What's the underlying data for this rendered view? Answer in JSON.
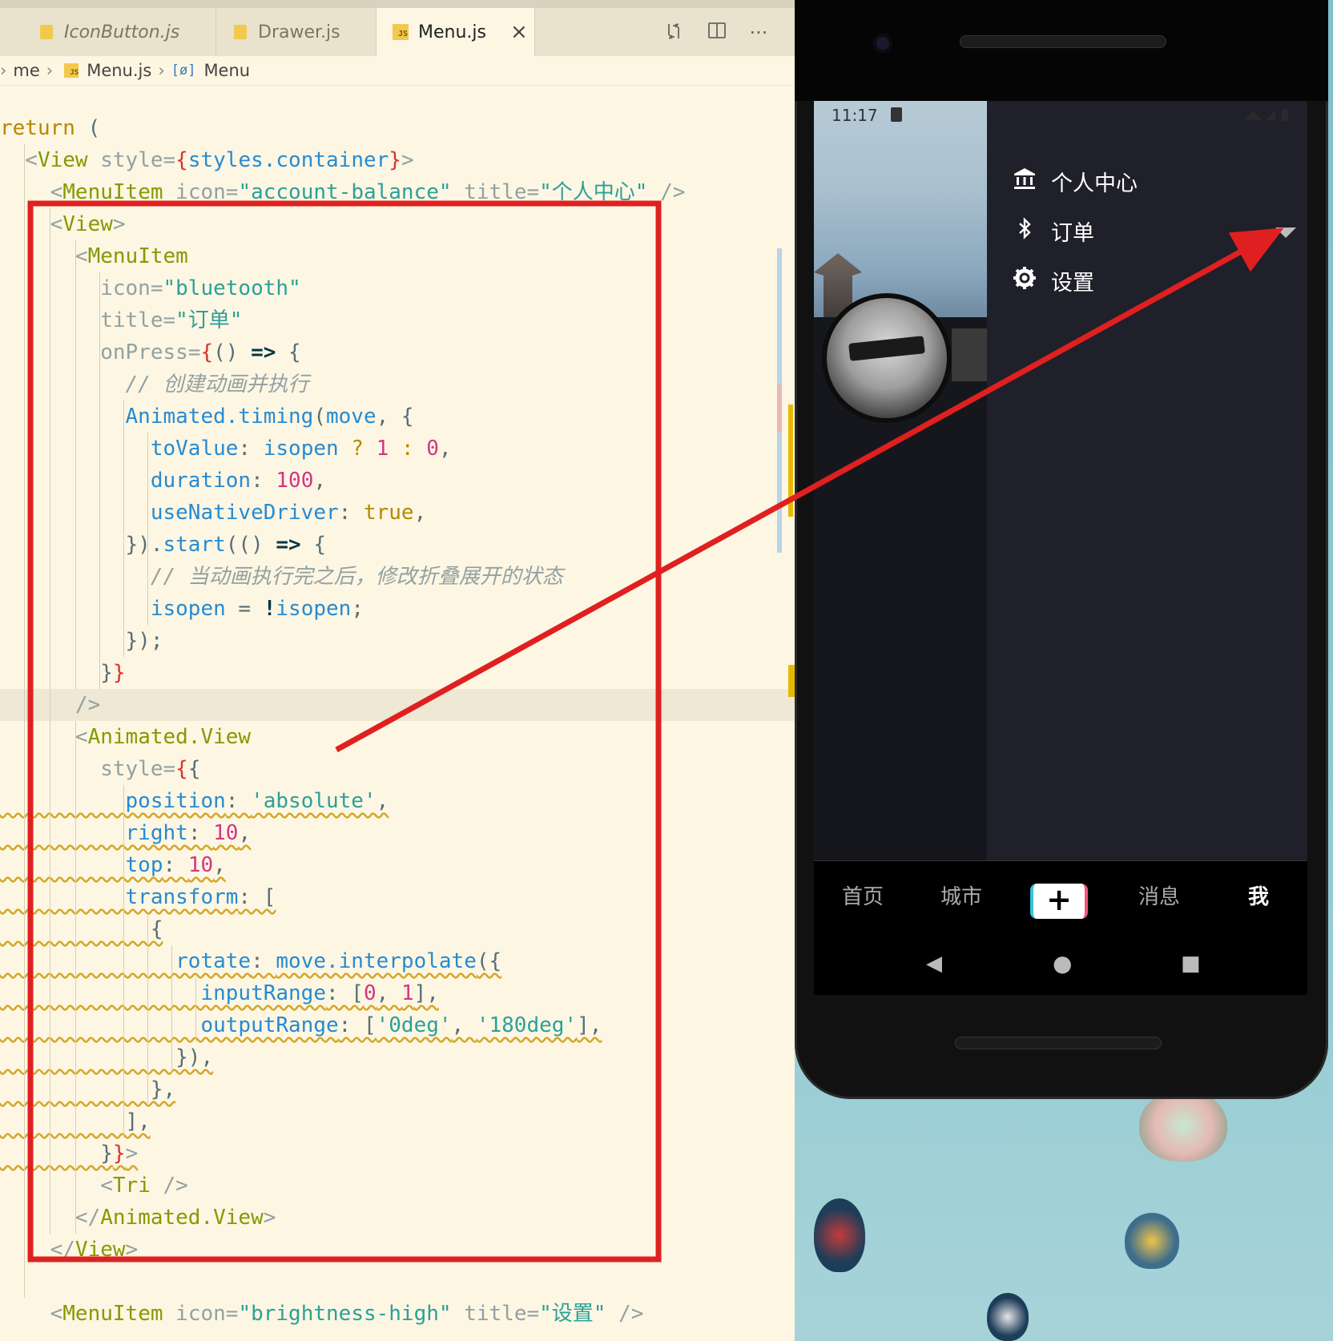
{
  "editor": {
    "tabs": [
      {
        "label": "IconButton.js",
        "active": false
      },
      {
        "label": "Drawer.js",
        "active": false
      },
      {
        "label": "Menu.js",
        "active": true
      }
    ],
    "tab_close": "×",
    "toolbar_icons": [
      "compare-changes-icon",
      "split-editor-icon",
      "more-actions-icon"
    ],
    "toolbar_more": "···",
    "breadcrumb": {
      "parts": [
        "me",
        "Menu.js",
        "Menu"
      ],
      "sep": "›",
      "symbol": "[ø]"
    },
    "js_badge": "JS",
    "colors": {
      "keyword": "#b58900",
      "tag": "#859900",
      "string": "#2aa198",
      "number": "#d33682",
      "property": "#268bd2",
      "comment": "#93a1a1",
      "background": "#fdf6e3"
    },
    "code_lines": [
      [
        {
          "t": "return",
          "c": "kw"
        },
        {
          "t": " (",
          "c": "pun"
        }
      ],
      [
        {
          "t": "  <",
          "c": "attr"
        },
        {
          "t": "View",
          "c": "tag"
        },
        {
          "t": " style=",
          "c": "attr"
        },
        {
          "t": "{",
          "c": "br"
        },
        {
          "t": "styles.container",
          "c": "prop"
        },
        {
          "t": "}",
          "c": "br"
        },
        {
          "t": ">",
          "c": "attr"
        }
      ],
      [
        {
          "t": "    <",
          "c": "attr"
        },
        {
          "t": "MenuItem",
          "c": "tag"
        },
        {
          "t": " icon=",
          "c": "attr"
        },
        {
          "t": "\"account-balance\"",
          "c": "str"
        },
        {
          "t": " title=",
          "c": "attr"
        },
        {
          "t": "\"个人中心\"",
          "c": "str"
        },
        {
          "t": " />",
          "c": "attr"
        }
      ],
      [
        {
          "t": "    <",
          "c": "attr"
        },
        {
          "t": "View",
          "c": "tag"
        },
        {
          "t": ">",
          "c": "attr"
        }
      ],
      [
        {
          "t": "      <",
          "c": "attr"
        },
        {
          "t": "MenuItem",
          "c": "tag"
        }
      ],
      [
        {
          "t": "        icon=",
          "c": "attr"
        },
        {
          "t": "\"bluetooth\"",
          "c": "str"
        }
      ],
      [
        {
          "t": "        title=",
          "c": "attr"
        },
        {
          "t": "\"订单\"",
          "c": "str"
        }
      ],
      [
        {
          "t": "        onPress=",
          "c": "attr"
        },
        {
          "t": "{",
          "c": "br"
        },
        {
          "t": "() ",
          "c": "pun"
        },
        {
          "t": "=>",
          "c": "op"
        },
        {
          "t": " {",
          "c": "pun"
        }
      ],
      [
        {
          "t": "          // 创建动画并执行",
          "c": "cm"
        }
      ],
      [
        {
          "t": "          Animated.timing",
          "c": "prop"
        },
        {
          "t": "(",
          "c": "pun"
        },
        {
          "t": "move",
          "c": "prop"
        },
        {
          "t": ", {",
          "c": "pun"
        }
      ],
      [
        {
          "t": "            toValue",
          "c": "prop"
        },
        {
          "t": ": ",
          "c": "pun"
        },
        {
          "t": "isopen",
          "c": "prop"
        },
        {
          "t": " ? ",
          "c": "kw"
        },
        {
          "t": "1",
          "c": "num"
        },
        {
          "t": " : ",
          "c": "kw"
        },
        {
          "t": "0",
          "c": "num"
        },
        {
          "t": ",",
          "c": "pun"
        }
      ],
      [
        {
          "t": "            duration",
          "c": "prop"
        },
        {
          "t": ": ",
          "c": "pun"
        },
        {
          "t": "100",
          "c": "num"
        },
        {
          "t": ",",
          "c": "pun"
        }
      ],
      [
        {
          "t": "            useNativeDriver",
          "c": "prop"
        },
        {
          "t": ": ",
          "c": "pun"
        },
        {
          "t": "true",
          "c": "kw"
        },
        {
          "t": ",",
          "c": "pun"
        }
      ],
      [
        {
          "t": "          }).",
          "c": "pun"
        },
        {
          "t": "start",
          "c": "prop"
        },
        {
          "t": "(() ",
          "c": "pun"
        },
        {
          "t": "=>",
          "c": "op"
        },
        {
          "t": " {",
          "c": "pun"
        }
      ],
      [
        {
          "t": "            // 当动画执行完之后，修改折叠展开的状态",
          "c": "cm"
        }
      ],
      [
        {
          "t": "            isopen",
          "c": "prop"
        },
        {
          "t": " = ",
          "c": "pun"
        },
        {
          "t": "!",
          "c": "op"
        },
        {
          "t": "isopen",
          "c": "prop"
        },
        {
          "t": ";",
          "c": "pun"
        }
      ],
      [
        {
          "t": "          });",
          "c": "pun"
        }
      ],
      [
        {
          "t": "        }",
          "c": "pun"
        },
        {
          "t": "}",
          "c": "br"
        }
      ],
      [
        {
          "t": "      />",
          "c": "attr"
        }
      ],
      [
        {
          "t": "      <",
          "c": "attr"
        },
        {
          "t": "Animated.View",
          "c": "tag"
        }
      ],
      [
        {
          "t": "        style=",
          "c": "attr"
        },
        {
          "t": "{",
          "c": "br"
        },
        {
          "t": "{",
          "c": "pun"
        }
      ],
      [
        {
          "t": "          position",
          "c": "prop"
        },
        {
          "t": ": ",
          "c": "pun"
        },
        {
          "t": "'absolute'",
          "c": "str"
        },
        {
          "t": ",",
          "c": "pun"
        }
      ],
      [
        {
          "t": "          right",
          "c": "prop"
        },
        {
          "t": ": ",
          "c": "pun"
        },
        {
          "t": "10",
          "c": "num"
        },
        {
          "t": ",",
          "c": "pun"
        }
      ],
      [
        {
          "t": "          top",
          "c": "prop"
        },
        {
          "t": ": ",
          "c": "pun"
        },
        {
          "t": "10",
          "c": "num"
        },
        {
          "t": ",",
          "c": "pun"
        }
      ],
      [
        {
          "t": "          transform",
          "c": "prop"
        },
        {
          "t": ": [",
          "c": "pun"
        }
      ],
      [
        {
          "t": "            {",
          "c": "pun"
        }
      ],
      [
        {
          "t": "              rotate",
          "c": "prop"
        },
        {
          "t": ": ",
          "c": "pun"
        },
        {
          "t": "move.interpolate",
          "c": "prop"
        },
        {
          "t": "({",
          "c": "pun"
        }
      ],
      [
        {
          "t": "                inputRange",
          "c": "prop"
        },
        {
          "t": ": [",
          "c": "pun"
        },
        {
          "t": "0",
          "c": "num"
        },
        {
          "t": ", ",
          "c": "pun"
        },
        {
          "t": "1",
          "c": "num"
        },
        {
          "t": "],",
          "c": "pun"
        }
      ],
      [
        {
          "t": "                outputRange",
          "c": "prop"
        },
        {
          "t": ": [",
          "c": "pun"
        },
        {
          "t": "'0deg'",
          "c": "str"
        },
        {
          "t": ", ",
          "c": "pun"
        },
        {
          "t": "'180deg'",
          "c": "str"
        },
        {
          "t": "],",
          "c": "pun"
        }
      ],
      [
        {
          "t": "              }),",
          "c": "pun"
        }
      ],
      [
        {
          "t": "            },",
          "c": "pun"
        }
      ],
      [
        {
          "t": "          ],",
          "c": "pun"
        }
      ],
      [
        {
          "t": "        }",
          "c": "pun"
        },
        {
          "t": "}",
          "c": "br"
        },
        {
          "t": ">",
          "c": "attr"
        }
      ],
      [
        {
          "t": "        <",
          "c": "attr"
        },
        {
          "t": "Tri",
          "c": "tag"
        },
        {
          "t": " />",
          "c": "attr"
        }
      ],
      [
        {
          "t": "      </",
          "c": "attr"
        },
        {
          "t": "Animated.View",
          "c": "tag"
        },
        {
          "t": ">",
          "c": "attr"
        }
      ],
      [
        {
          "t": "    </",
          "c": "attr"
        },
        {
          "t": "View",
          "c": "tag"
        },
        {
          "t": ">",
          "c": "attr"
        }
      ],
      [
        {
          "t": "",
          "c": "pun"
        }
      ],
      [
        {
          "t": "    <",
          "c": "attr"
        },
        {
          "t": "MenuItem",
          "c": "tag"
        },
        {
          "t": " icon=",
          "c": "attr"
        },
        {
          "t": "\"brightness-high\"",
          "c": "str"
        },
        {
          "t": " title=",
          "c": "attr"
        },
        {
          "t": "\"设置\"",
          "c": "str"
        },
        {
          "t": " />",
          "c": "attr"
        }
      ]
    ]
  },
  "phone": {
    "status_time": "11:17",
    "menu_items": [
      {
        "label": "个人中心",
        "icon": "account-balance-icon",
        "glyph": "🏛"
      },
      {
        "label": "订单",
        "icon": "bluetooth-icon",
        "glyph": "ᛒ"
      },
      {
        "label": "设置",
        "icon": "gear-icon",
        "glyph": "⚙"
      }
    ],
    "bottom_tabs": [
      "首页",
      "城市",
      "消息",
      "我"
    ],
    "plus_label": "+",
    "nav": {
      "back": "◀",
      "home": "●",
      "recents": "■"
    },
    "annotation_color": "#e02020"
  }
}
